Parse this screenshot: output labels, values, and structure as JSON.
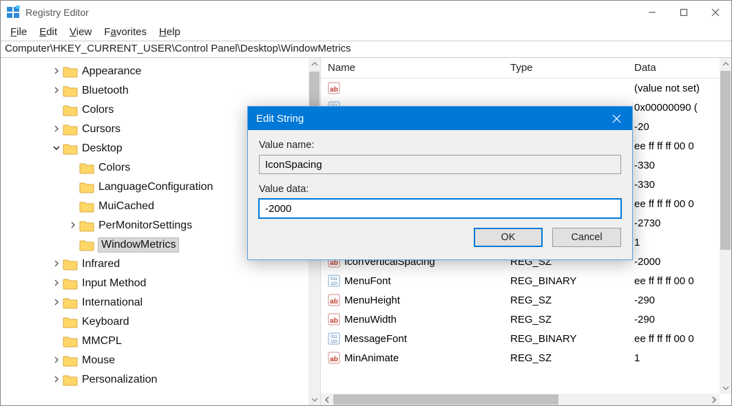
{
  "title": "Registry Editor",
  "menu": {
    "file": "File",
    "edit": "Edit",
    "view": "View",
    "favorites": "Favorites",
    "help": "Help"
  },
  "address": "Computer\\HKEY_CURRENT_USER\\Control Panel\\Desktop\\WindowMetrics",
  "tree": [
    {
      "indent": 3,
      "expand": ">",
      "label": "Appearance"
    },
    {
      "indent": 3,
      "expand": ">",
      "label": "Bluetooth"
    },
    {
      "indent": 3,
      "expand": "",
      "label": "Colors"
    },
    {
      "indent": 3,
      "expand": ">",
      "label": "Cursors"
    },
    {
      "indent": 3,
      "expand": "v",
      "label": "Desktop"
    },
    {
      "indent": 4,
      "expand": "",
      "label": "Colors"
    },
    {
      "indent": 4,
      "expand": "",
      "label": "LanguageConfiguration"
    },
    {
      "indent": 4,
      "expand": "",
      "label": "MuiCached"
    },
    {
      "indent": 4,
      "expand": ">",
      "label": "PerMonitorSettings"
    },
    {
      "indent": 4,
      "expand": "",
      "label": "WindowMetrics",
      "selected": true
    },
    {
      "indent": 3,
      "expand": ">",
      "label": "Infrared"
    },
    {
      "indent": 3,
      "expand": ">",
      "label": "Input Method"
    },
    {
      "indent": 3,
      "expand": ">",
      "label": "International"
    },
    {
      "indent": 3,
      "expand": "",
      "label": "Keyboard"
    },
    {
      "indent": 3,
      "expand": "",
      "label": "MMCPL"
    },
    {
      "indent": 3,
      "expand": ">",
      "label": "Mouse"
    },
    {
      "indent": 3,
      "expand": ">",
      "label": "Personalization"
    }
  ],
  "cols": {
    "name": "Name",
    "type": "Type",
    "data": "Data"
  },
  "rows": [
    {
      "kind": "ab",
      "name": "",
      "type": "",
      "data": "(value not set)"
    },
    {
      "kind": "bin",
      "name": "",
      "type": "",
      "data": "0x00000090 ("
    },
    {
      "kind": "ab",
      "name": "",
      "type": "",
      "data": "-20"
    },
    {
      "kind": "bin",
      "name": "",
      "type": "",
      "data": "ee ff ff ff 00 0"
    },
    {
      "kind": "ab",
      "name": "",
      "type": "",
      "data": "-330"
    },
    {
      "kind": "ab",
      "name": "",
      "type": "",
      "data": "-330"
    },
    {
      "kind": "bin",
      "name": "",
      "type": "",
      "data": "ee ff ff ff 00 0"
    },
    {
      "kind": "ab",
      "name": "",
      "type": "",
      "data": "-2730"
    },
    {
      "kind": "ab",
      "name": "",
      "type": "",
      "data": "1"
    },
    {
      "kind": "ab",
      "name": "IconVerticalSpacing",
      "type": "REG_SZ",
      "data": "-2000"
    },
    {
      "kind": "bin",
      "name": "MenuFont",
      "type": "REG_BINARY",
      "data": "ee ff ff ff 00 0"
    },
    {
      "kind": "ab",
      "name": "MenuHeight",
      "type": "REG_SZ",
      "data": "-290"
    },
    {
      "kind": "ab",
      "name": "MenuWidth",
      "type": "REG_SZ",
      "data": "-290"
    },
    {
      "kind": "bin",
      "name": "MessageFont",
      "type": "REG_BINARY",
      "data": "ee ff ff ff 00 0"
    },
    {
      "kind": "ab",
      "name": "MinAnimate",
      "type": "REG_SZ",
      "data": "1"
    }
  ],
  "dialog": {
    "title": "Edit String",
    "value_name_label": "Value name:",
    "value_name": "IconSpacing",
    "value_data_label": "Value data:",
    "value_data": "-2000",
    "ok": "OK",
    "cancel": "Cancel"
  }
}
